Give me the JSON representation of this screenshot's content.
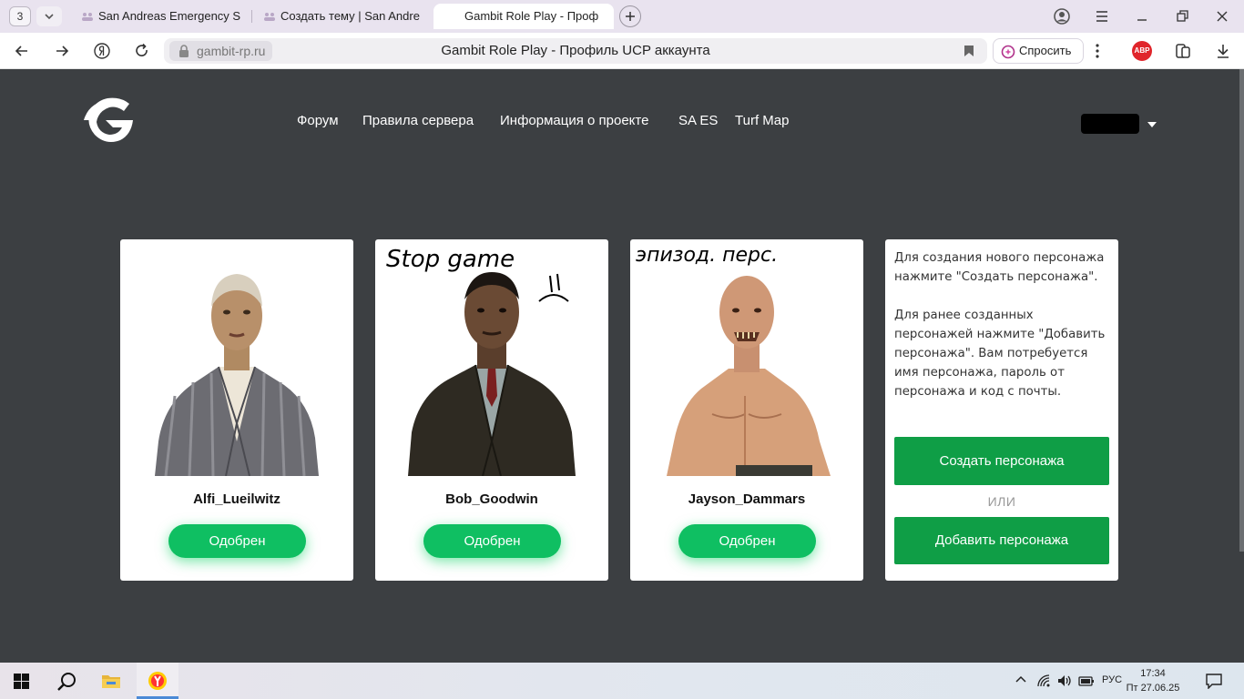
{
  "browser": {
    "tab_count": "3",
    "tabs": [
      {
        "label": "San Andreas Emergency S"
      },
      {
        "label": "Создать тему | San Andre"
      },
      {
        "label": "Gambit Role Play - Проф"
      }
    ],
    "url": "gambit-rp.ru",
    "page_title": "Gambit Role Play - Профиль UCP аккаунта",
    "ask_label": "Спросить",
    "abp_label": "ABP"
  },
  "site": {
    "nav": [
      "Форум",
      "Правила сервера",
      "Информация о проекте",
      "SA ES",
      "Turf Map"
    ]
  },
  "characters": [
    {
      "name": "Alfi_Lueilwitz",
      "status": "Одобрен"
    },
    {
      "name": "Bob_Goodwin",
      "status": "Одобрен",
      "annotation": "Stop game"
    },
    {
      "name": "Jayson_Dammars",
      "status": "Одобрен",
      "annotation": "эпизод. перс."
    }
  ],
  "info": {
    "paragraph1": "Для создания нового персонажа нажмите \"Создать персонажа\".",
    "paragraph2": "Для ранее созданных персонажей нажмите \"Добавить персонажа\". Вам потребуется имя персонажа, пароль от персонажа и код с почты.",
    "create_label": "Создать персонажа",
    "or_label": "ИЛИ",
    "add_label": "Добавить персонажа"
  },
  "taskbar": {
    "lang": "РУС",
    "time": "17:34",
    "date": "Пт 27.06.25"
  }
}
